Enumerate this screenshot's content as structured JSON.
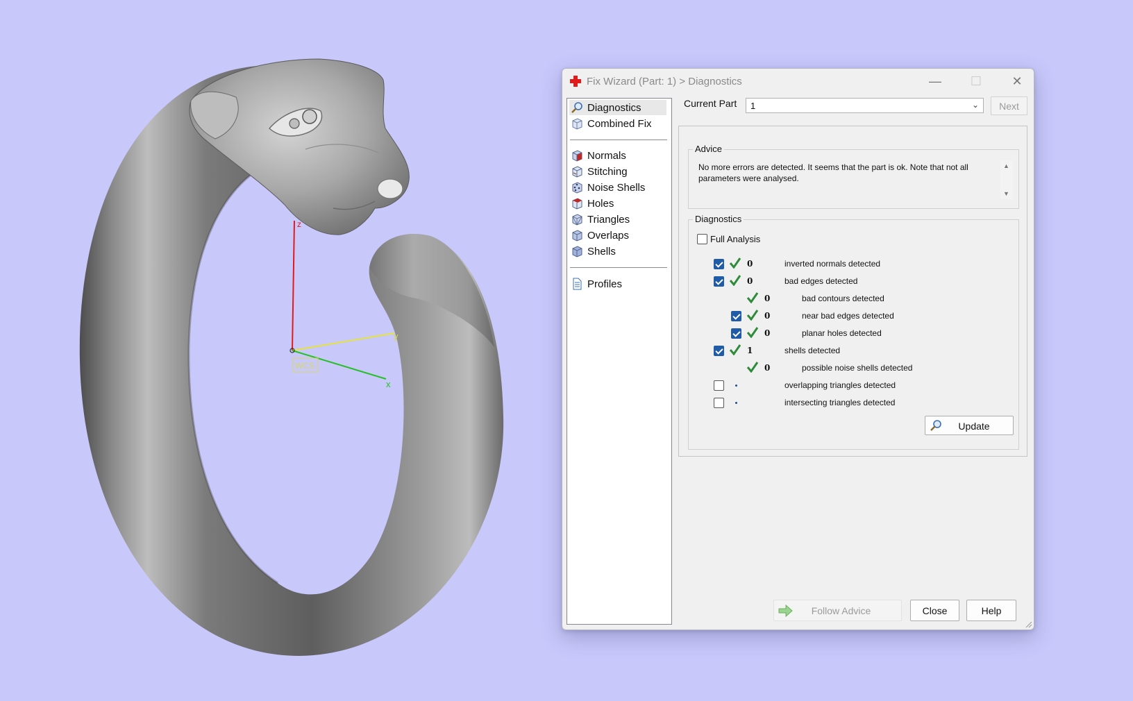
{
  "viewport": {
    "background": "#c8c8fb",
    "axes": {
      "z_label": "z",
      "y_label": "y",
      "x_label": "x",
      "origin_label": "WCS"
    }
  },
  "dialog": {
    "title": "Fix Wizard (Part: 1) > Diagnostics",
    "window_controls": {
      "minimize": "—",
      "maximize": "☐",
      "close": "✕"
    },
    "nav": {
      "items": [
        {
          "label": "Diagnostics",
          "icon": "magnifier-icon",
          "selected": true
        },
        {
          "label": "Combined Fix",
          "icon": "cube-icon"
        },
        {
          "label": "Normals",
          "icon": "normals-cube-icon"
        },
        {
          "label": "Stitching",
          "icon": "stitching-cube-icon"
        },
        {
          "label": "Noise Shells",
          "icon": "noise-shells-cube-icon"
        },
        {
          "label": "Holes",
          "icon": "holes-cube-icon"
        },
        {
          "label": "Triangles",
          "icon": "triangles-cube-icon"
        },
        {
          "label": "Overlaps",
          "icon": "overlaps-cube-icon"
        },
        {
          "label": "Shells",
          "icon": "shells-cube-icon"
        },
        {
          "label": "Profiles",
          "icon": "document-icon"
        }
      ]
    },
    "current_part": {
      "label": "Current Part",
      "value": "1"
    },
    "next_button": "Next",
    "advice": {
      "title": "Advice",
      "text": "No more errors are detected. It seems that the part is ok. Note that not all parameters were analysed."
    },
    "diagnostics": {
      "title": "Diagnostics",
      "full_analysis_label": "Full Analysis",
      "full_analysis_checked": false,
      "rows": [
        {
          "checkbox": "on",
          "status": "ok",
          "count": "0",
          "text": "inverted normals detected",
          "indent": 0
        },
        {
          "checkbox": "on",
          "status": "ok",
          "count": "0",
          "text": "bad edges detected",
          "indent": 0
        },
        {
          "checkbox": "none",
          "status": "ok",
          "count": "0",
          "text": "bad contours detected",
          "indent": 1
        },
        {
          "checkbox": "on",
          "status": "ok",
          "count": "0",
          "text": "near bad edges detected",
          "indent": 1
        },
        {
          "checkbox": "on",
          "status": "ok",
          "count": "0",
          "text": "planar holes detected",
          "indent": 1
        },
        {
          "checkbox": "on",
          "status": "ok",
          "count": "1",
          "text": "shells detected",
          "indent": 0
        },
        {
          "checkbox": "none",
          "status": "ok",
          "count": "0",
          "text": "possible noise shells detected",
          "indent": 1
        },
        {
          "checkbox": "off",
          "status": "none",
          "count": "",
          "text": "overlapping triangles detected",
          "indent": 0
        },
        {
          "checkbox": "off",
          "status": "none",
          "count": "",
          "text": "intersecting triangles detected",
          "indent": 0
        }
      ],
      "update_button": "Update"
    },
    "buttons": {
      "follow_advice": "Follow Advice",
      "close": "Close",
      "help": "Help"
    },
    "colors": {
      "check_blue": "#1f5ba6",
      "ok_green": "#2e8b3a",
      "title_icon_red": "#e01b1b"
    }
  }
}
